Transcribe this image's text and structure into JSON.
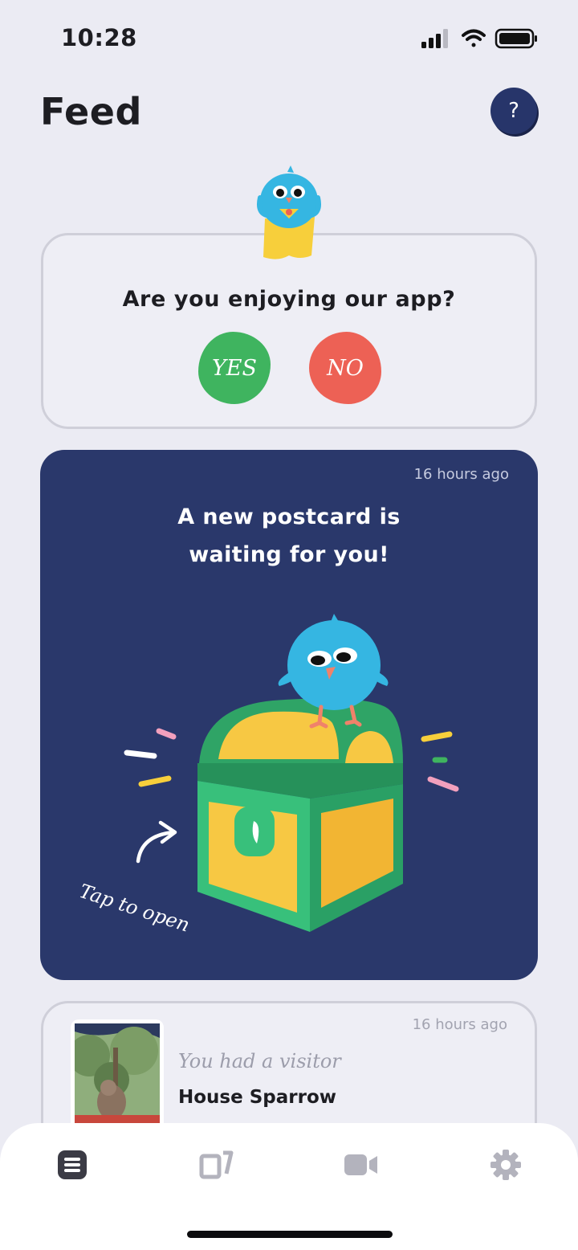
{
  "status_bar": {
    "time": "10:28"
  },
  "header": {
    "title": "Feed",
    "help_label": "?"
  },
  "rating_card": {
    "question": "Are you enjoying our app?",
    "yes_label": "YES",
    "no_label": "NO",
    "yes_color": "#3fb45f",
    "no_color": "#ed6155"
  },
  "postcard_card": {
    "timestamp": "16 hours ago",
    "title_line1": "A new postcard is",
    "title_line2": "waiting for you!",
    "tap_hint": "Tap to open",
    "background_color": "#2a386b"
  },
  "visitor_card": {
    "timestamp": "16 hours ago",
    "subtitle": "You had a visitor",
    "bird_name": "House Sparrow"
  },
  "tab_bar": {
    "items": [
      {
        "icon": "feed-icon",
        "active": true
      },
      {
        "icon": "postcards-icon",
        "active": false
      },
      {
        "icon": "video-icon",
        "active": false
      },
      {
        "icon": "settings-icon",
        "active": false
      }
    ]
  }
}
